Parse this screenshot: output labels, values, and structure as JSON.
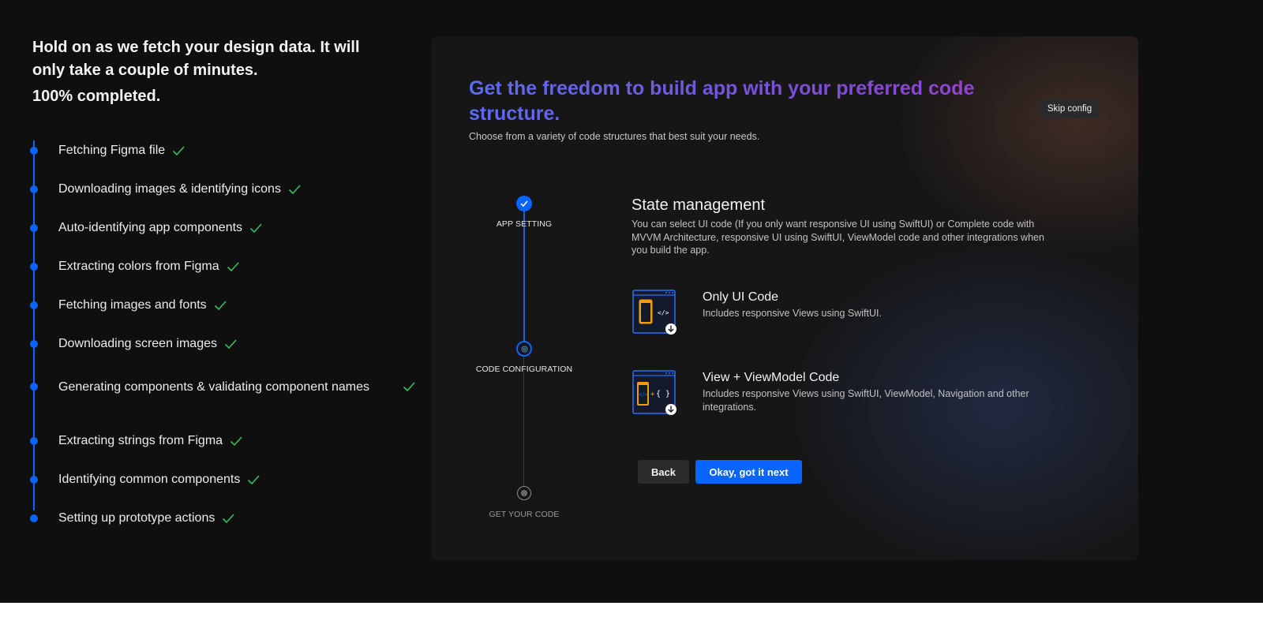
{
  "progress": {
    "heading": "Hold on as we fetch your design data. It will only take a couple of minutes.",
    "percent_text": "100% completed.",
    "steps": [
      {
        "label": "Fetching Figma file",
        "done": true
      },
      {
        "label": "Downloading images & identifying icons",
        "done": true
      },
      {
        "label": "Auto-identifying app components",
        "done": true
      },
      {
        "label": "Extracting colors from Figma",
        "done": true
      },
      {
        "label": "Fetching images and fonts",
        "done": true
      },
      {
        "label": "Downloading screen images",
        "done": true
      },
      {
        "label": "Generating components & validating component names",
        "done": true
      },
      {
        "label": "Extracting strings from Figma",
        "done": true
      },
      {
        "label": "Identifying common components",
        "done": true
      },
      {
        "label": "Setting up prototype actions",
        "done": true
      }
    ]
  },
  "panel": {
    "title": "Get the freedom to build app with your preferred code structure.",
    "subtitle": "Choose from a variety of code structures that best suit your needs.",
    "skip_label": "Skip config",
    "stepper": [
      {
        "label": "APP SETTING",
        "state": "done"
      },
      {
        "label": "CODE CONFIGURATION",
        "state": "active"
      },
      {
        "label": "GET YOUR CODE",
        "state": "pending"
      }
    ],
    "section_title": "State management",
    "section_desc": "You can select UI code (If you only want responsive UI using SwiftUI) or Complete code with MVVM Architecture, responsive UI using SwiftUI, ViewModel code and other integrations when you build the app.",
    "options": [
      {
        "title": "Only UI Code",
        "desc": "Includes responsive Views using SwiftUI.",
        "icon": "ui-code-icon"
      },
      {
        "title": "View + ViewModel Code",
        "desc": "Includes responsive Views using SwiftUI, ViewModel, Navigation and other integrations.",
        "icon": "viewmodel-code-icon"
      }
    ],
    "back_label": "Back",
    "next_label": "Okay, got it next"
  },
  "colors": {
    "accent": "#0a64ff",
    "check": "#2fc25b",
    "background": "#0f0f10",
    "panel": "#161617"
  }
}
